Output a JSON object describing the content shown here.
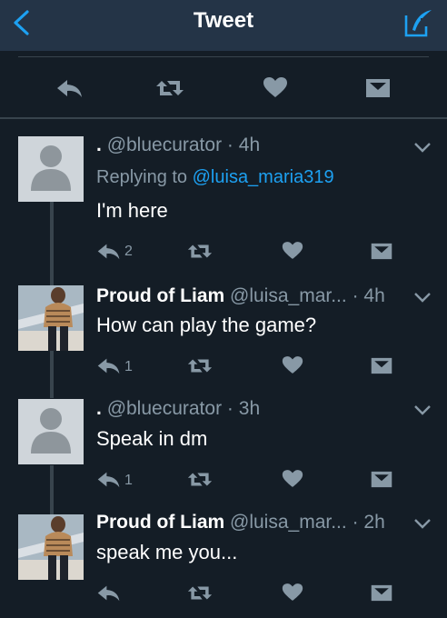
{
  "header": {
    "title": "Tweet",
    "back_icon": "chevron-left-icon",
    "compose_icon": "compose-icon"
  },
  "main_tweet_actions": [
    "reply-icon",
    "retweet-icon",
    "like-icon",
    "message-icon"
  ],
  "replies": [
    {
      "display_name": ".",
      "handle": "@bluecurator",
      "separator": "·",
      "time": "4h",
      "replying_prefix": "Replying to",
      "replying_to": "@luisa_maria319",
      "text": "I'm here",
      "reply_count": "2",
      "avatar": "default-avatar"
    },
    {
      "display_name": "Proud of Liam",
      "handle": "@luisa_mar...",
      "separator": "·",
      "time": "4h",
      "text": "How can play the game?",
      "reply_count": "1",
      "avatar": "photo-avatar"
    },
    {
      "display_name": ".",
      "handle": "@bluecurator",
      "separator": "·",
      "time": "3h",
      "text": "Speak in dm",
      "reply_count": "1",
      "avatar": "default-avatar"
    },
    {
      "display_name": "Proud of Liam",
      "handle": "@luisa_mar...",
      "separator": "·",
      "time": "2h",
      "text": "speak me you...",
      "reply_count": "",
      "avatar": "photo-avatar"
    }
  ],
  "colors": {
    "background": "#141d26",
    "nav": "#243447",
    "muted": "#8899a6",
    "accent": "#1da1f2",
    "divider": "#38444d"
  }
}
